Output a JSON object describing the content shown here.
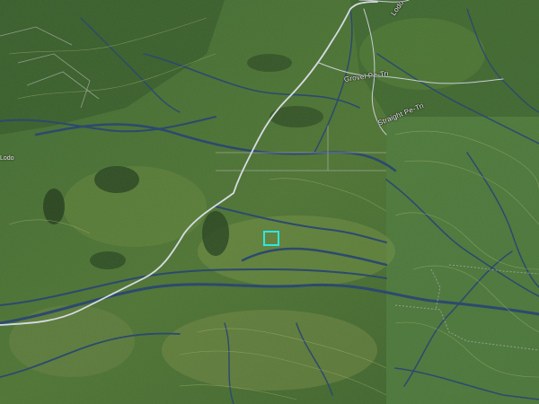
{
  "map": {
    "type": "satellite-terrain",
    "layers": [
      "satellite-imagery",
      "contour-lines",
      "waterways",
      "roads",
      "boundaries"
    ],
    "colors": {
      "vegetation_dark": "#24401f",
      "vegetation_mid": "#3b5f2d",
      "vegetation_light": "#6c8a3e",
      "waterway": "#2c4a6e",
      "road": "#c9ced6",
      "contour": "#9fae6a",
      "selection": "#2ee6e0"
    }
  },
  "roads": [
    {
      "name": "Grovel Pe-Tri"
    },
    {
      "name": "Straight Pe-Tri"
    },
    {
      "name": "Lodo Pe-Tri"
    }
  ],
  "edge_labels": {
    "left": "Lodo"
  },
  "selection": {
    "icon": "selection-square-icon"
  }
}
